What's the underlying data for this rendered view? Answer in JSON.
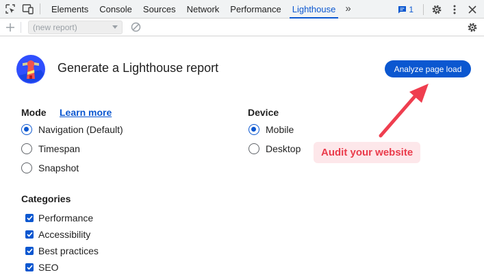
{
  "tabbar": {
    "tabs": [
      {
        "label": "Elements",
        "active": false
      },
      {
        "label": "Console",
        "active": false
      },
      {
        "label": "Sources",
        "active": false
      },
      {
        "label": "Network",
        "active": false
      },
      {
        "label": "Performance",
        "active": false
      },
      {
        "label": "Lighthouse",
        "active": true
      }
    ],
    "more_label": "»",
    "issues_count": "1"
  },
  "toolbar2": {
    "report_select_value": "(new report)"
  },
  "main": {
    "title": "Generate a Lighthouse report",
    "analyze_button_label": "Analyze page load",
    "mode": {
      "label": "Mode",
      "learn_more": "Learn more",
      "options": [
        {
          "label": "Navigation (Default)",
          "checked": true
        },
        {
          "label": "Timespan",
          "checked": false
        },
        {
          "label": "Snapshot",
          "checked": false
        }
      ]
    },
    "device": {
      "label": "Device",
      "options": [
        {
          "label": "Mobile",
          "checked": true
        },
        {
          "label": "Desktop",
          "checked": false
        }
      ]
    },
    "categories": {
      "label": "Categories",
      "items": [
        {
          "label": "Performance",
          "checked": true
        },
        {
          "label": "Accessibility",
          "checked": true
        },
        {
          "label": "Best practices",
          "checked": true
        },
        {
          "label": "SEO",
          "checked": true
        }
      ]
    }
  },
  "annotation": {
    "text": "Audit your website"
  },
  "colors": {
    "accent": "#0b57d0",
    "annotation": "#ea3b4b",
    "annotation_bg": "#fde7ea"
  },
  "icons": {
    "inspect": "inspect-element-icon",
    "device": "device-toolbar-icon",
    "issues": "issues-icon",
    "settings": "gear-icon",
    "menu": "kebab-menu-icon",
    "close": "close-icon",
    "clear": "clear-icon",
    "logo": "lighthouse-logo"
  }
}
